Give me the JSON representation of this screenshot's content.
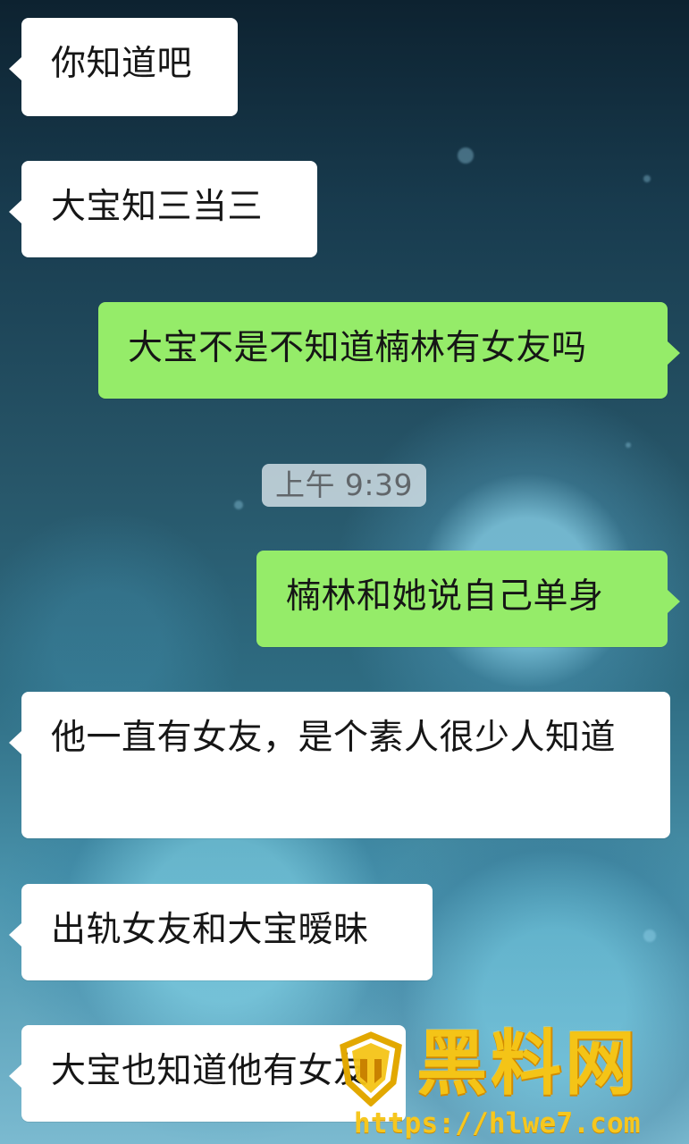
{
  "chat": {
    "messages": [
      {
        "side": "left",
        "text": "你知道吧"
      },
      {
        "side": "left",
        "text": "大宝知三当三"
      },
      {
        "side": "right",
        "text": "大宝不是不知道楠林有女友吗"
      },
      {
        "side": "right",
        "text": "楠林和她说自己单身"
      },
      {
        "side": "left",
        "text": "他一直有女友，是个素人很少人知道"
      },
      {
        "side": "left",
        "text": "出轨女友和大宝暧昧"
      },
      {
        "side": "left",
        "text": "大宝也知道他有女友"
      }
    ],
    "timestamp": "上午 9:39"
  },
  "watermark": {
    "logo_icon": "shield-logo-icon",
    "text": "黑料网",
    "url": "https://hlwe7.com"
  },
  "colors": {
    "incoming_bubble": "#ffffff",
    "outgoing_bubble": "#95ec69",
    "timestamp_bg": "#e1ecf1",
    "watermark": "#f4c417"
  }
}
